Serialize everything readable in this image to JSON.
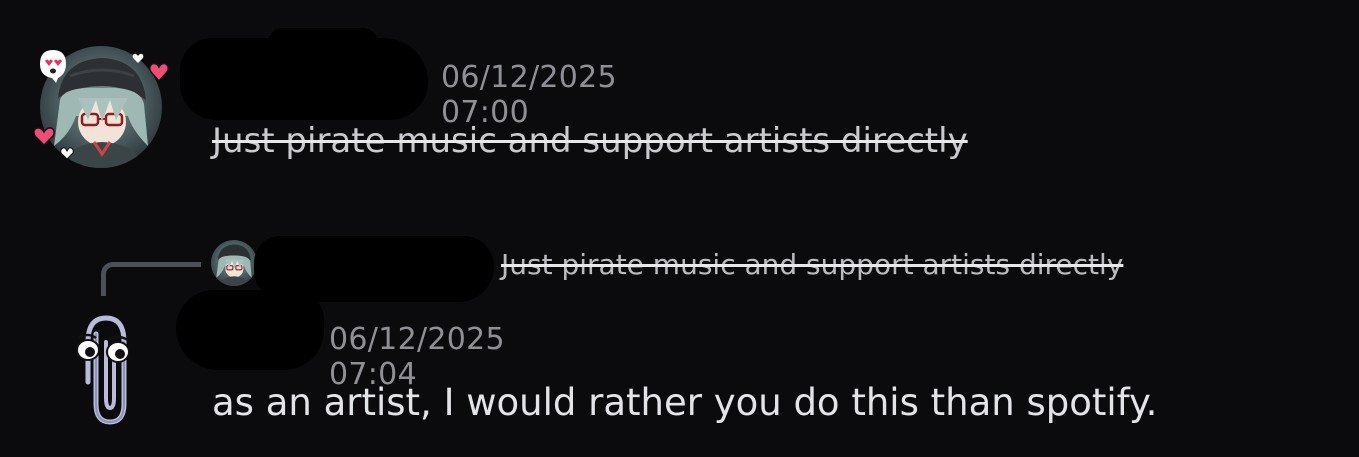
{
  "messages": [
    {
      "timestamp": "06/12/2025 07:00",
      "text": "Just pirate music and support artists directly",
      "strikethrough": true,
      "avatar_icon": "anime-girl-avatar-icon"
    },
    {
      "reply_to": {
        "text": "Just pirate music and support artists directly",
        "strikethrough": true,
        "avatar_icon": "anime-girl-avatar-icon"
      },
      "timestamp": "06/12/2025 07:04",
      "text": "as an artist, I would rather you do this than spotify.",
      "avatar_icon": "paperclip-clippy-icon"
    }
  ],
  "colors": {
    "background": "#0b0b0e",
    "timestamp": "#8e9096",
    "message_text": "#e3e4e8",
    "redaction": "#000000",
    "heart": "#f04c77"
  }
}
